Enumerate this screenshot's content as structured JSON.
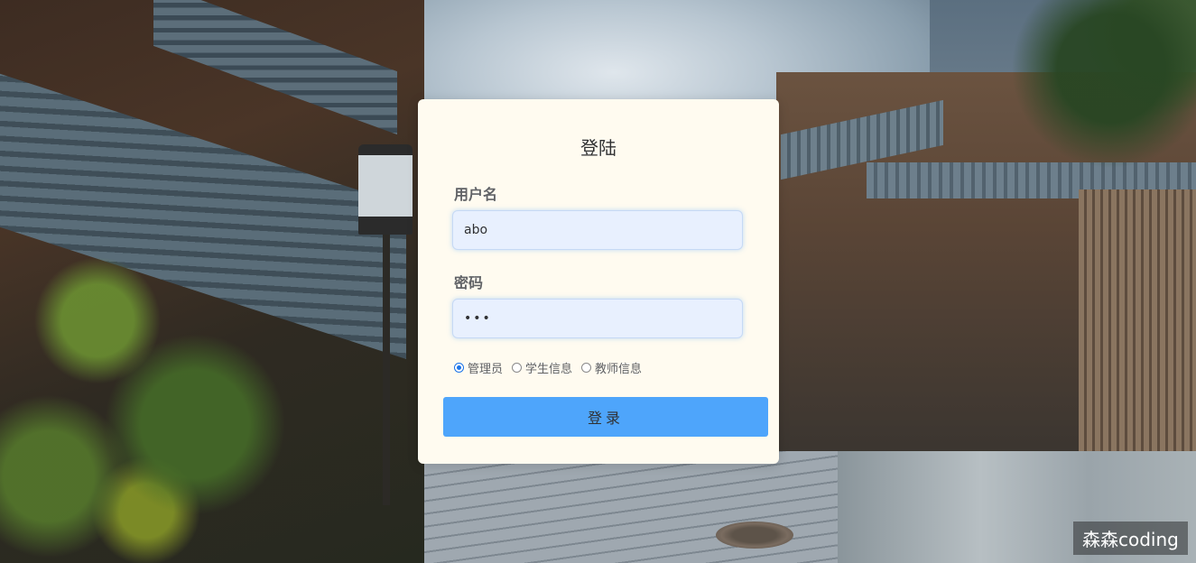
{
  "login": {
    "title": "登陆",
    "username_label": "用户名",
    "username_value": "abo",
    "password_label": "密码",
    "password_value": "•••",
    "roles": [
      {
        "label": "管理员",
        "checked": true
      },
      {
        "label": "学生信息",
        "checked": false
      },
      {
        "label": "教师信息",
        "checked": false
      }
    ],
    "submit_label": "登录"
  },
  "watermark": "森森coding",
  "colors": {
    "card_bg": "#fffbf0",
    "button_bg": "#4ea5fb",
    "input_bg": "#e8f0fe",
    "radio_accent": "#1a73e8"
  }
}
